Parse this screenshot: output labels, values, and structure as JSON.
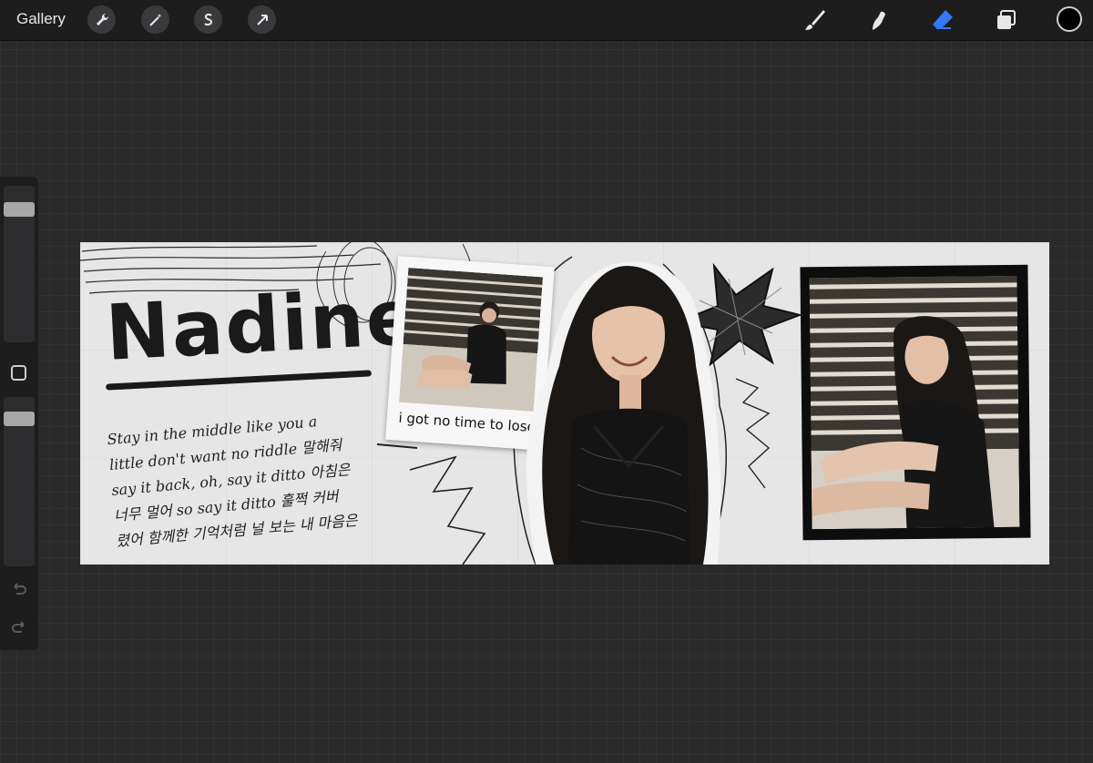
{
  "toolbar": {
    "gallery_label": "Gallery",
    "left_icons": [
      "wrench-icon",
      "magic-wand-icon",
      "selection-icon",
      "transform-arrow-icon"
    ],
    "right_tools": [
      "brush-icon",
      "smudge-icon",
      "eraser-icon",
      "layers-icon"
    ],
    "active_tool": "eraser-icon",
    "active_color": "#000000",
    "accent": "#3478f6"
  },
  "sidebar": {
    "brush_size_level": 0.07,
    "opacity_level": 0.07,
    "icons": [
      "modify-square-icon",
      "undo-icon",
      "redo-icon"
    ]
  },
  "artwork": {
    "title": "Nadine.",
    "lyrics": [
      "Stay in the middle like you a",
      "little don't want no riddle 말해줘",
      "say it back, oh, say it ditto 아침은",
      "너무 멀어 so say it ditto 훌쩍 커버",
      "렸어 함께한 기억처럼 널 보는 내 마음은"
    ],
    "polaroid_caption": "i got no time to lose"
  }
}
